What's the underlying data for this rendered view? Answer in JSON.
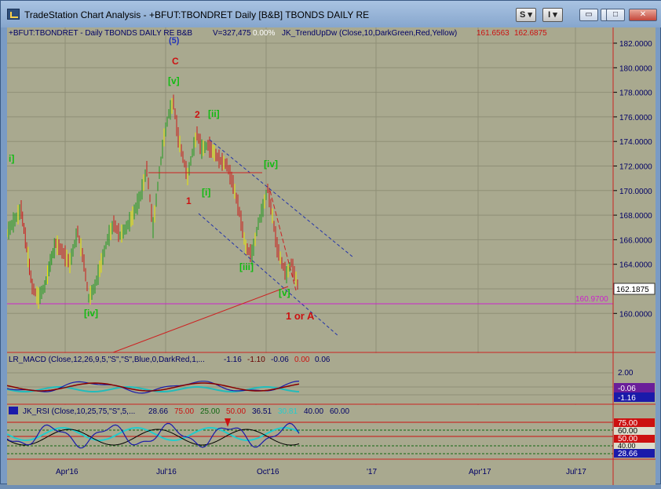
{
  "window": {
    "title": "TradeStation Chart Analysis - +BFUT:TBONDRET Daily [B&B] TBONDS DAILY RE",
    "btn_s": "S",
    "btn_i": "I"
  },
  "header": {
    "symbol": "+BFUT:TBONDRET - Daily  TBONDS DAILY RE  B&B",
    "volume": "V=327,475",
    "change": "0.00%",
    "indicator": "JK_TrendUpDw (Close,10,DarkGreen,Red,Yellow)",
    "val1": "161.6563",
    "val2": "162.6875"
  },
  "price_axis": {
    "ticks": [
      "182.0000",
      "180.0000",
      "178.0000",
      "176.0000",
      "174.0000",
      "172.0000",
      "170.0000",
      "168.0000",
      "166.0000",
      "164.0000",
      "162.0000",
      "160.0000"
    ],
    "last_price": "162.1875",
    "support_label": "160.9700"
  },
  "labels": {
    "wave_5": "(5)",
    "wave_c": "C",
    "wave_v_top": "[v]",
    "wave_2": "2",
    "wave_ii": "[ii]",
    "wave_i_left": "i]",
    "wave_i": "[i]",
    "wave_1": "1",
    "wave_iv_top": "[iv]",
    "wave_iii": "[iii]",
    "wave_v_bot": "[v]",
    "wave_1_or_a": "1 or A",
    "wave_iv_bot": "[iv]"
  },
  "macd": {
    "label": "LR_MACD (Close,12,26,9,5,\"S\",\"S\",Blue,0,DarkRed,1,...",
    "v1": "-1.16",
    "v2": "-1.10",
    "v3": "-0.06",
    "v4": "0.00",
    "v5": "0.06",
    "axis_top": "2.00",
    "badge_purple": "-0.06",
    "badge_blue": "-1.16"
  },
  "rsi": {
    "label": "JK_RSI (Close,10,25,75,\"S\",5,...",
    "v1": "28.66",
    "v2": "75.00",
    "v3": "25.00",
    "v4": "50.00",
    "v5": "36.51",
    "v6": "30.81",
    "v7": "40.00",
    "v8": "60.00",
    "badge_75": "75.00",
    "badge_60": "60.00",
    "badge_50": "50.00",
    "badge_40": "40.00",
    "badge_28": "28.66"
  },
  "time_axis": [
    "Apr'16",
    "Jul'16",
    "Oct'16",
    "'17",
    "Apr'17",
    "Jul'17"
  ],
  "colors": {
    "bg": "#a9a98f",
    "up": "#1f9a1f",
    "down": "#cc1a1a",
    "neutral": "#e8e800",
    "axis_text": "#000066"
  }
}
